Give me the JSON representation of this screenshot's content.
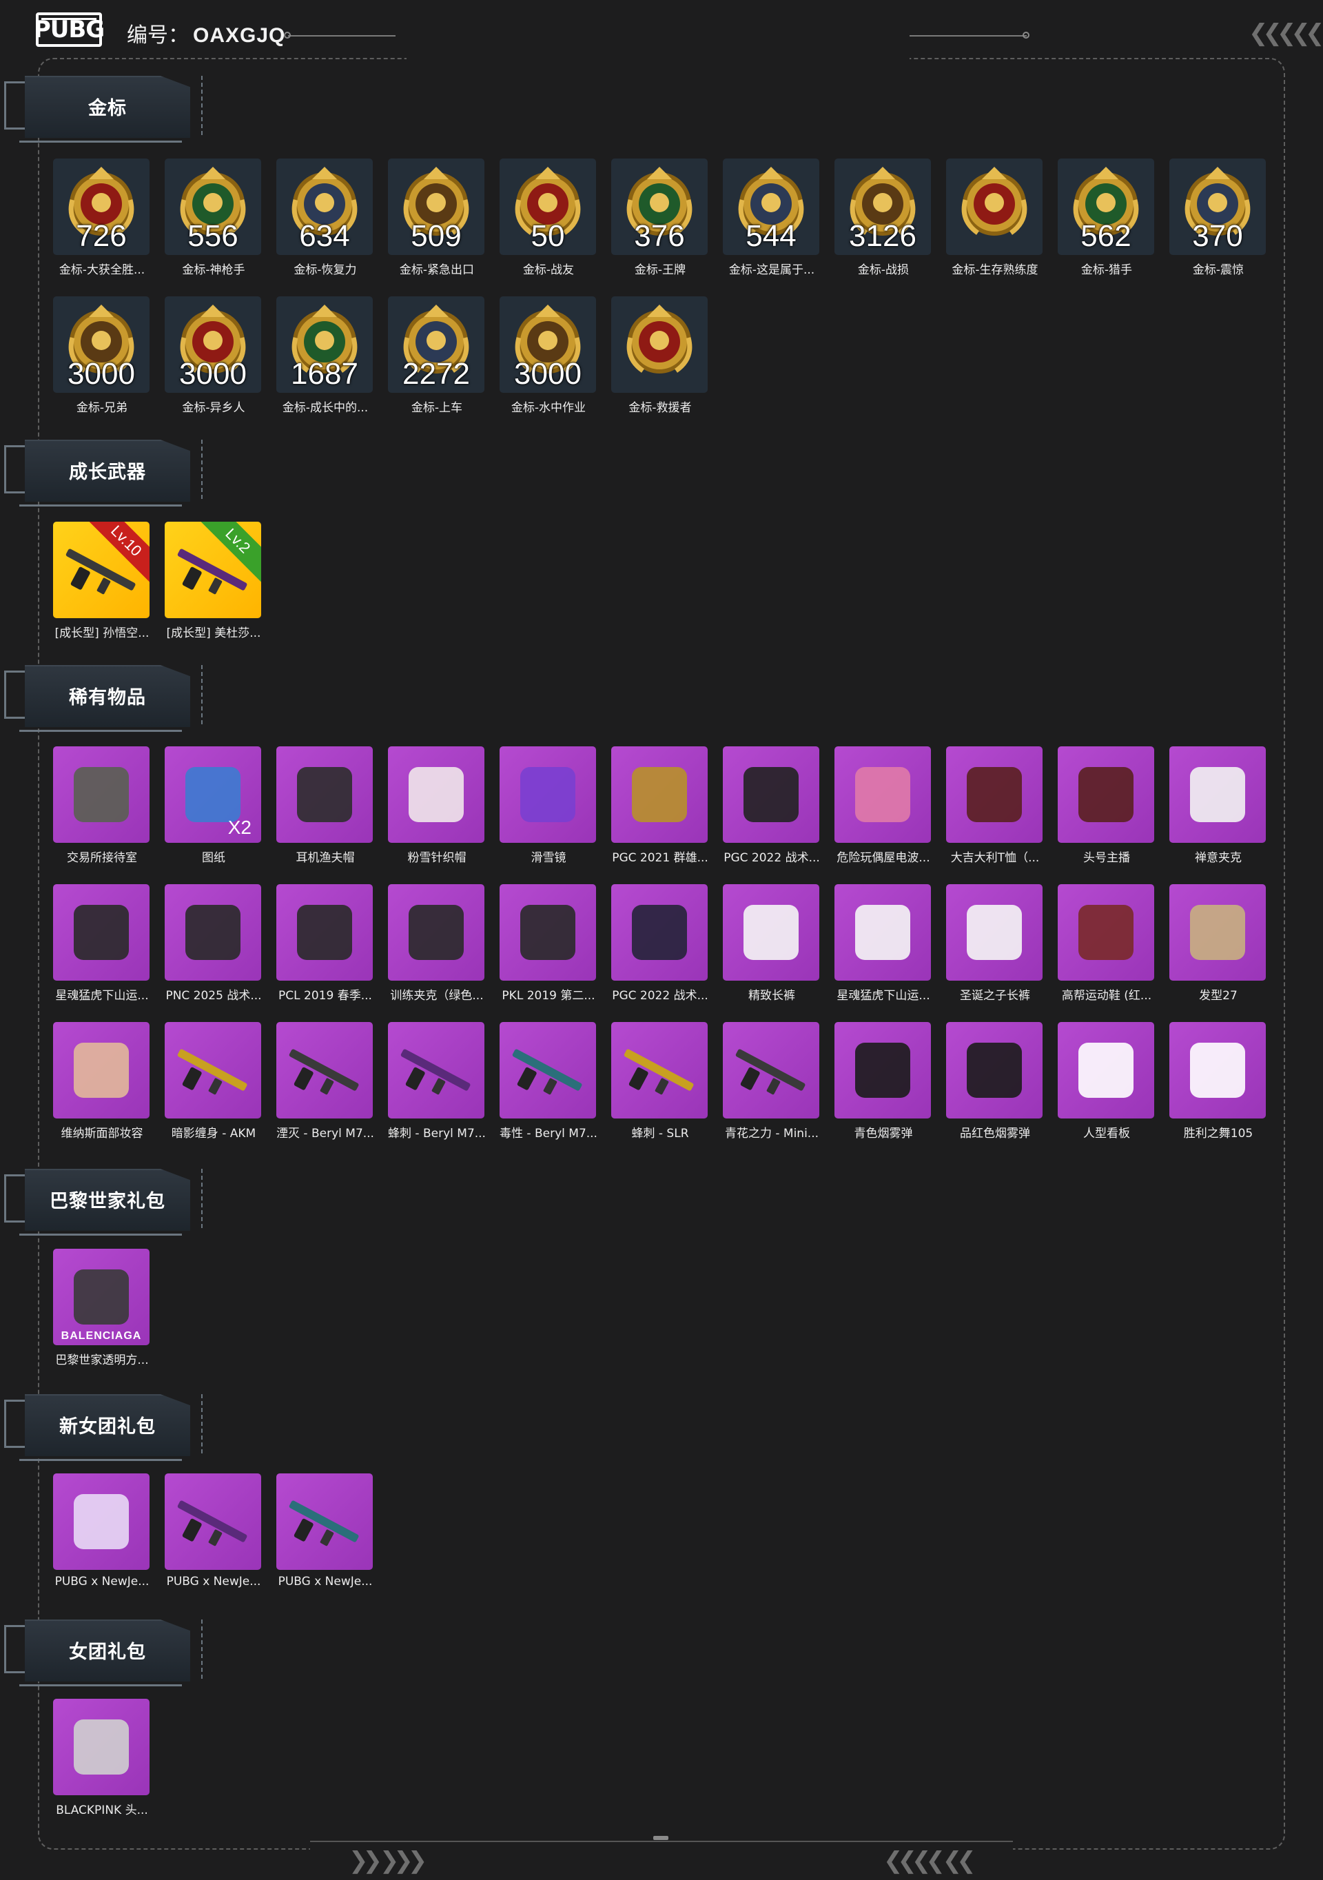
{
  "header": {
    "logo_text": "PUBG",
    "account_label": "编号：",
    "account_code": "OAXGJQ"
  },
  "colors": {
    "background": "#1d1d1e",
    "badge_tile": "#242e38",
    "gold_tile": "#ffc20a",
    "purple_tile": "#a83fc6",
    "plate": "#2a323a"
  },
  "sections": [
    {
      "title": "金标",
      "items": [
        {
          "label": "金标-大获全胜...",
          "count": "726",
          "icon": "medal-chicken-icon"
        },
        {
          "label": "金标-神枪手",
          "count": "556",
          "icon": "medal-target-icon"
        },
        {
          "label": "金标-恢复力",
          "count": "634",
          "icon": "medal-fist-icon"
        },
        {
          "label": "金标-紧急出口",
          "count": "509",
          "icon": "medal-wings-icon"
        },
        {
          "label": "金标-战友",
          "count": "50",
          "icon": "medal-doves-icon"
        },
        {
          "label": "金标-王牌",
          "count": "376",
          "icon": "medal-spade-icon"
        },
        {
          "label": "金标-这是属于...",
          "count": "544",
          "icon": "medal-soldier-icon"
        },
        {
          "label": "金标-战损",
          "count": "3126",
          "icon": "medal-trooper-icon"
        },
        {
          "label": "金标-生存熟练度",
          "count": "",
          "icon": "medal-parachute-icon"
        },
        {
          "label": "金标-猎手",
          "count": "562",
          "icon": "medal-helmet-icon"
        },
        {
          "label": "金标-震惊",
          "count": "370",
          "icon": "medal-grenade-icon"
        },
        {
          "label": "金标-兄弟",
          "count": "3000",
          "icon": "medal-squad-icon"
        },
        {
          "label": "金标-异乡人",
          "count": "3000",
          "icon": "medal-stranger-icon"
        },
        {
          "label": "金标-成长中的...",
          "count": "1687",
          "icon": "medal-growth-icon"
        },
        {
          "label": "金标-上车",
          "count": "2272",
          "icon": "medal-car-icon"
        },
        {
          "label": "金标-水中作业",
          "count": "3000",
          "icon": "medal-seal-icon"
        },
        {
          "label": "金标-救援者",
          "count": "",
          "icon": "medal-rescuer-icon"
        }
      ]
    },
    {
      "title": "成长武器",
      "items": [
        {
          "label": "[成长型] 孙悟空...",
          "level": "Lv.10",
          "icon": "sniper-rifle-icon"
        },
        {
          "label": "[成长型] 美杜莎...",
          "level": "Lv.2",
          "icon": "assault-rifle-icon"
        }
      ]
    },
    {
      "title": "稀有物品",
      "items": [
        {
          "label": "交易所接待室",
          "icon": "room-icon"
        },
        {
          "label": "图纸",
          "sub": "X2",
          "icon": "blueprint-icon"
        },
        {
          "label": "耳机渔夫帽",
          "icon": "bucket-hat-icon"
        },
        {
          "label": "粉雪针织帽",
          "icon": "knit-hat-icon"
        },
        {
          "label": "滑雪镜",
          "icon": "ski-goggles-icon"
        },
        {
          "label": "PGC 2021 群雄...",
          "icon": "mask-icon"
        },
        {
          "label": "PGC 2022 战术...",
          "icon": "vest-icon"
        },
        {
          "label": "危险玩偶屋电波...",
          "icon": "backpack-icon"
        },
        {
          "label": "大吉大利T恤（...",
          "icon": "tshirt-icon"
        },
        {
          "label": "头号主播",
          "icon": "tshirt-icon"
        },
        {
          "label": "禅意夹克",
          "icon": "hoodie-icon"
        },
        {
          "label": "星魂猛虎下山运...",
          "icon": "jacket-icon"
        },
        {
          "label": "PNC 2025 战术...",
          "icon": "jacket-icon"
        },
        {
          "label": "PCL 2019 春季...",
          "icon": "jacket-icon"
        },
        {
          "label": "训练夹克（绿色...",
          "icon": "jacket-icon"
        },
        {
          "label": "PKL 2019 第二...",
          "icon": "jacket-icon"
        },
        {
          "label": "PGC 2022 战术...",
          "icon": "coat-icon"
        },
        {
          "label": "精致长裤",
          "icon": "pants-icon"
        },
        {
          "label": "星魂猛虎下山运...",
          "icon": "pants-icon"
        },
        {
          "label": "圣诞之子长裤",
          "icon": "pants-icon"
        },
        {
          "label": "高帮运动鞋 (红...",
          "icon": "shoes-icon"
        },
        {
          "label": "发型27",
          "icon": "hair-icon"
        },
        {
          "label": "维纳斯面部妆容",
          "icon": "face-icon"
        },
        {
          "label": "暗影缠身 - AKM",
          "icon": "rifle-icon"
        },
        {
          "label": "湮灭 - Beryl M7...",
          "icon": "rifle-icon"
        },
        {
          "label": "蜂刺 - Beryl M7...",
          "icon": "rifle-icon"
        },
        {
          "label": "毒性 - Beryl M7...",
          "icon": "rifle-icon"
        },
        {
          "label": "蜂刺 - SLR",
          "icon": "rifle-icon"
        },
        {
          "label": "青花之力 - Mini...",
          "icon": "rifle-icon"
        },
        {
          "label": "青色烟雾弹",
          "icon": "smoke-grenade-icon"
        },
        {
          "label": "品红色烟雾弹",
          "icon": "smoke-grenade-icon"
        },
        {
          "label": "人型看板",
          "icon": "emote-sign-icon"
        },
        {
          "label": "胜利之舞105",
          "icon": "emote-dance-icon"
        }
      ]
    },
    {
      "title": "巴黎世家礼包",
      "items": [
        {
          "label": "巴黎世家透明方...",
          "brand": "BALENCIAGA",
          "icon": "sunglasses-icon"
        }
      ]
    },
    {
      "title": "新女团礼包",
      "items": [
        {
          "label": "PUBG x NewJe...",
          "icon": "helmet-icon"
        },
        {
          "label": "PUBG x NewJe...",
          "icon": "rifle-icon"
        },
        {
          "label": "PUBG x NewJe...",
          "icon": "rifle-icon"
        }
      ]
    },
    {
      "title": "女团礼包",
      "items": [
        {
          "label": "BLACKPINK 头...",
          "icon": "headphones-icon"
        }
      ]
    }
  ]
}
